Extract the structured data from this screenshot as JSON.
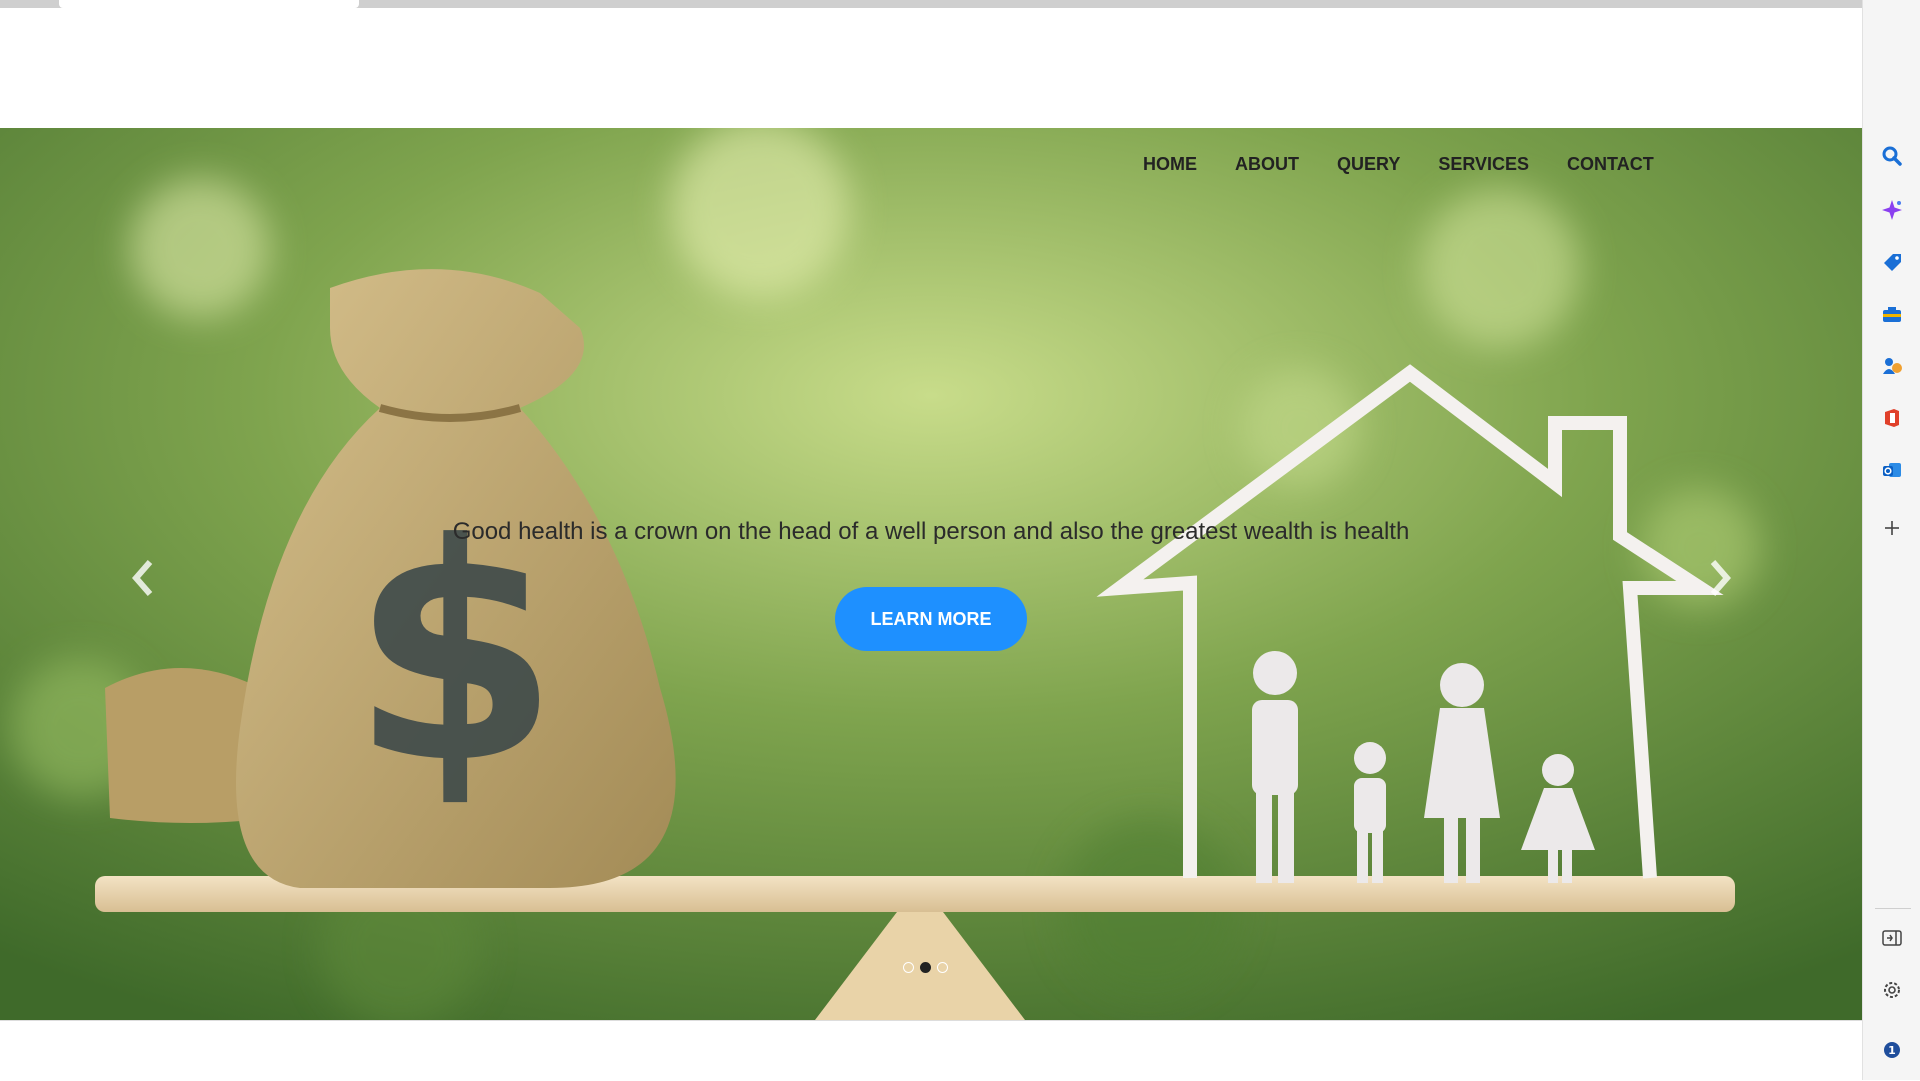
{
  "nav": {
    "items": [
      {
        "label": "HOME"
      },
      {
        "label": "ABOUT"
      },
      {
        "label": "QUERY"
      },
      {
        "label": "SERVICES"
      },
      {
        "label": "CONTACT"
      }
    ]
  },
  "hero": {
    "tagline": "Good health is a crown on the head of a well person and also the greatest wealth is health",
    "button_label": "LEARN MORE",
    "slide_count": 3,
    "active_slide": 2
  },
  "window": {
    "close_glyph": "✕",
    "more_glyph": "··"
  },
  "sidebar": {
    "icons": [
      "search-icon",
      "copilot-icon",
      "shopping-tag-icon",
      "tools-icon",
      "games-icon",
      "office-icon",
      "outlook-icon",
      "add-icon",
      "split-screen-icon",
      "settings-icon",
      "notification-badge-icon"
    ],
    "badge_count": "1"
  },
  "colors": {
    "accent": "#1e90ff",
    "nav_text": "#222222"
  }
}
